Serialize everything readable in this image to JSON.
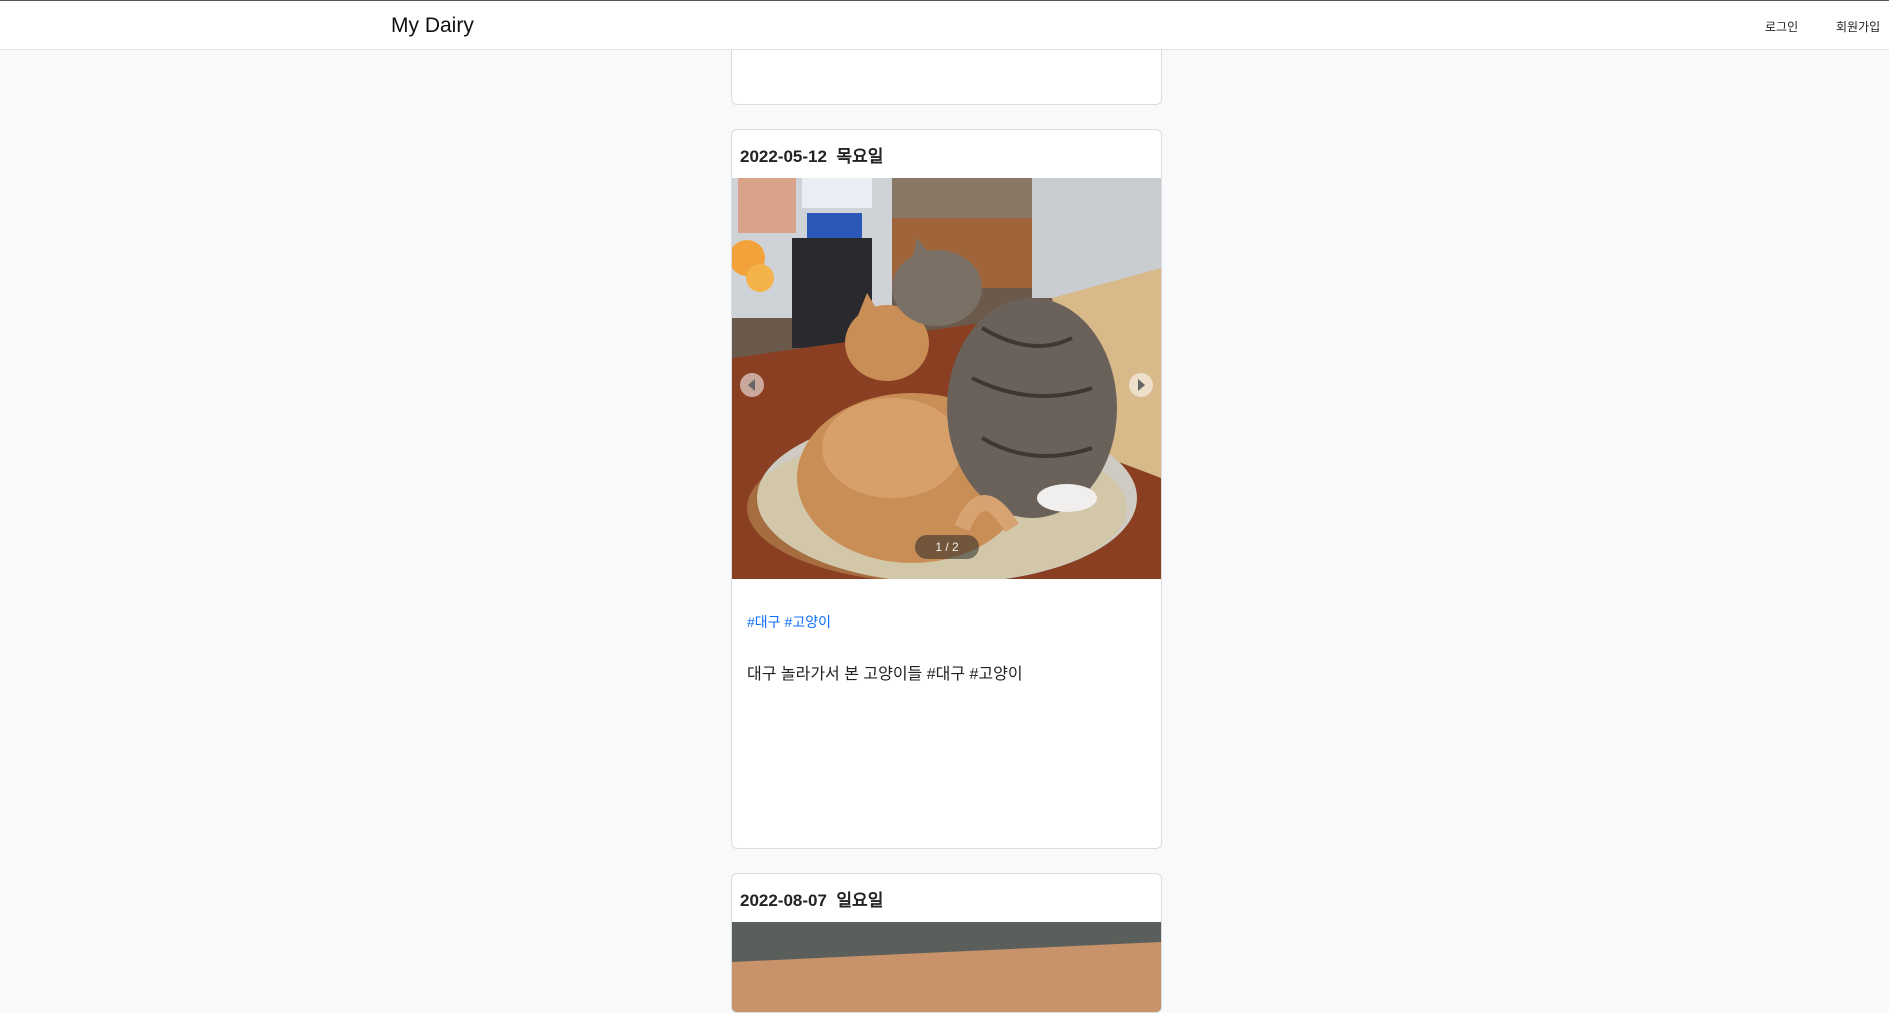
{
  "header": {
    "brand": "My Dairy",
    "login_label": "로그인",
    "signup_label": "회원가입"
  },
  "posts": [
    {
      "date": "2022-05-12",
      "weekday": "목요일",
      "carousel": {
        "counter": "1 / 2"
      },
      "tags": [
        "#대구",
        "#고양이"
      ],
      "body": "대구 놀라가서 본 고양이들 #대구 #고양이"
    },
    {
      "date": "2022-08-07",
      "weekday": "일요일"
    }
  ],
  "colors": {
    "background": "#f8f9fa",
    "tag": "#0d6efd"
  }
}
